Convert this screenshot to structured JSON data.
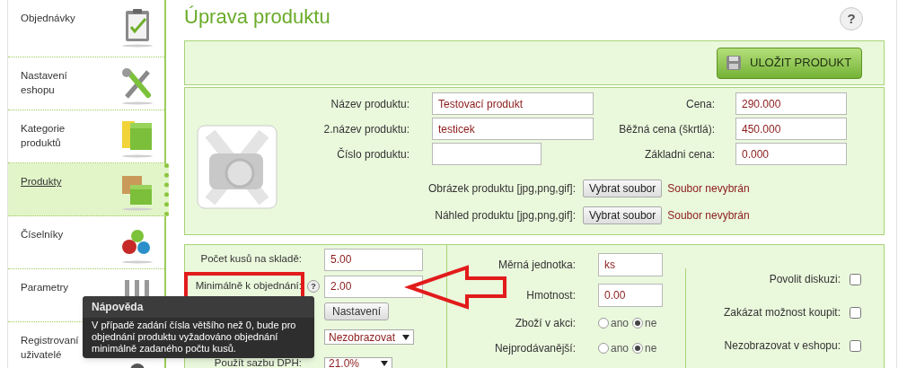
{
  "sidebar": {
    "items": [
      {
        "label": "Objednávky",
        "selected": false
      },
      {
        "label": "Nastavení eshopu",
        "selected": false
      },
      {
        "label": "Kategorie produktů",
        "selected": false
      },
      {
        "label": "Produkty",
        "selected": true
      },
      {
        "label": "Číselníky",
        "selected": false
      },
      {
        "label": "Parametry",
        "selected": false
      },
      {
        "label": "Registrovaní uživatelé",
        "selected": false
      }
    ]
  },
  "page": {
    "title": "Úprava produktu",
    "help": "?"
  },
  "toolbar": {
    "save_button": "ULOŽIT PRODUKT"
  },
  "product": {
    "rows": [
      {
        "label": "Název produktu:",
        "value": "Testovací produkt",
        "label_2": "Cena:",
        "value_2": "290.000"
      },
      {
        "label": "2.název produktu:",
        "value": "testicek",
        "label_2": "Běžná cena (škrtlá):",
        "value_2": "450.000"
      },
      {
        "label": "Číslo produktu:",
        "value": "",
        "label_2": "Základni cena:",
        "value_2": "0.000"
      }
    ],
    "files": [
      {
        "label": "Obrázek produktu [jpg,png,gif]:",
        "button": "Vybrat soubor",
        "status": "Soubor nevybrán"
      },
      {
        "label": "Náhled produktu [jpg,png,gif]:",
        "button": "Vybrat soubor",
        "status": "Soubor nevybrán"
      }
    ]
  },
  "stock": {
    "rows": [
      {
        "kind": "input",
        "label": "Počet kusů na skladě:",
        "value": "5.00"
      },
      {
        "kind": "input",
        "label": "Minimálně k objednání:",
        "value": "2.00",
        "help": "?"
      },
      {
        "kind": "button",
        "button": "Nastavení"
      },
      {
        "kind": "select",
        "value": "Nezobrazovat"
      },
      {
        "kind": "select",
        "label": "Použít sazbu DPH:",
        "value": "21.0%"
      }
    ]
  },
  "details": {
    "rows": [
      {
        "kind": "input",
        "label": "Měrná jednotka:",
        "value": "ks"
      },
      {
        "kind": "input",
        "label": "Hmotnost:",
        "value": "0.00"
      },
      {
        "kind": "radio",
        "label": "Zboží v akci:",
        "options": [
          {
            "label": "ano",
            "selected": false
          },
          {
            "label": "ne",
            "selected": true
          }
        ]
      },
      {
        "kind": "radio",
        "label": "Nejprodávanější:",
        "options": [
          {
            "label": "ano",
            "selected": false
          },
          {
            "label": "ne",
            "selected": true
          }
        ]
      }
    ]
  },
  "flags": [
    {
      "label": "Povolit diskuzi:",
      "checked": false
    },
    {
      "label": "Zakázat možnost koupit:",
      "checked": false
    },
    {
      "label": "Nezobrazovat v eshopu:",
      "checked": false
    }
  ],
  "tooltip": {
    "title": "Nápověda",
    "text": "V případě zadání čísla většího než 0, bude pro objednání produktu vyžadováno objednání minimálně zadaného počtu kusů."
  }
}
